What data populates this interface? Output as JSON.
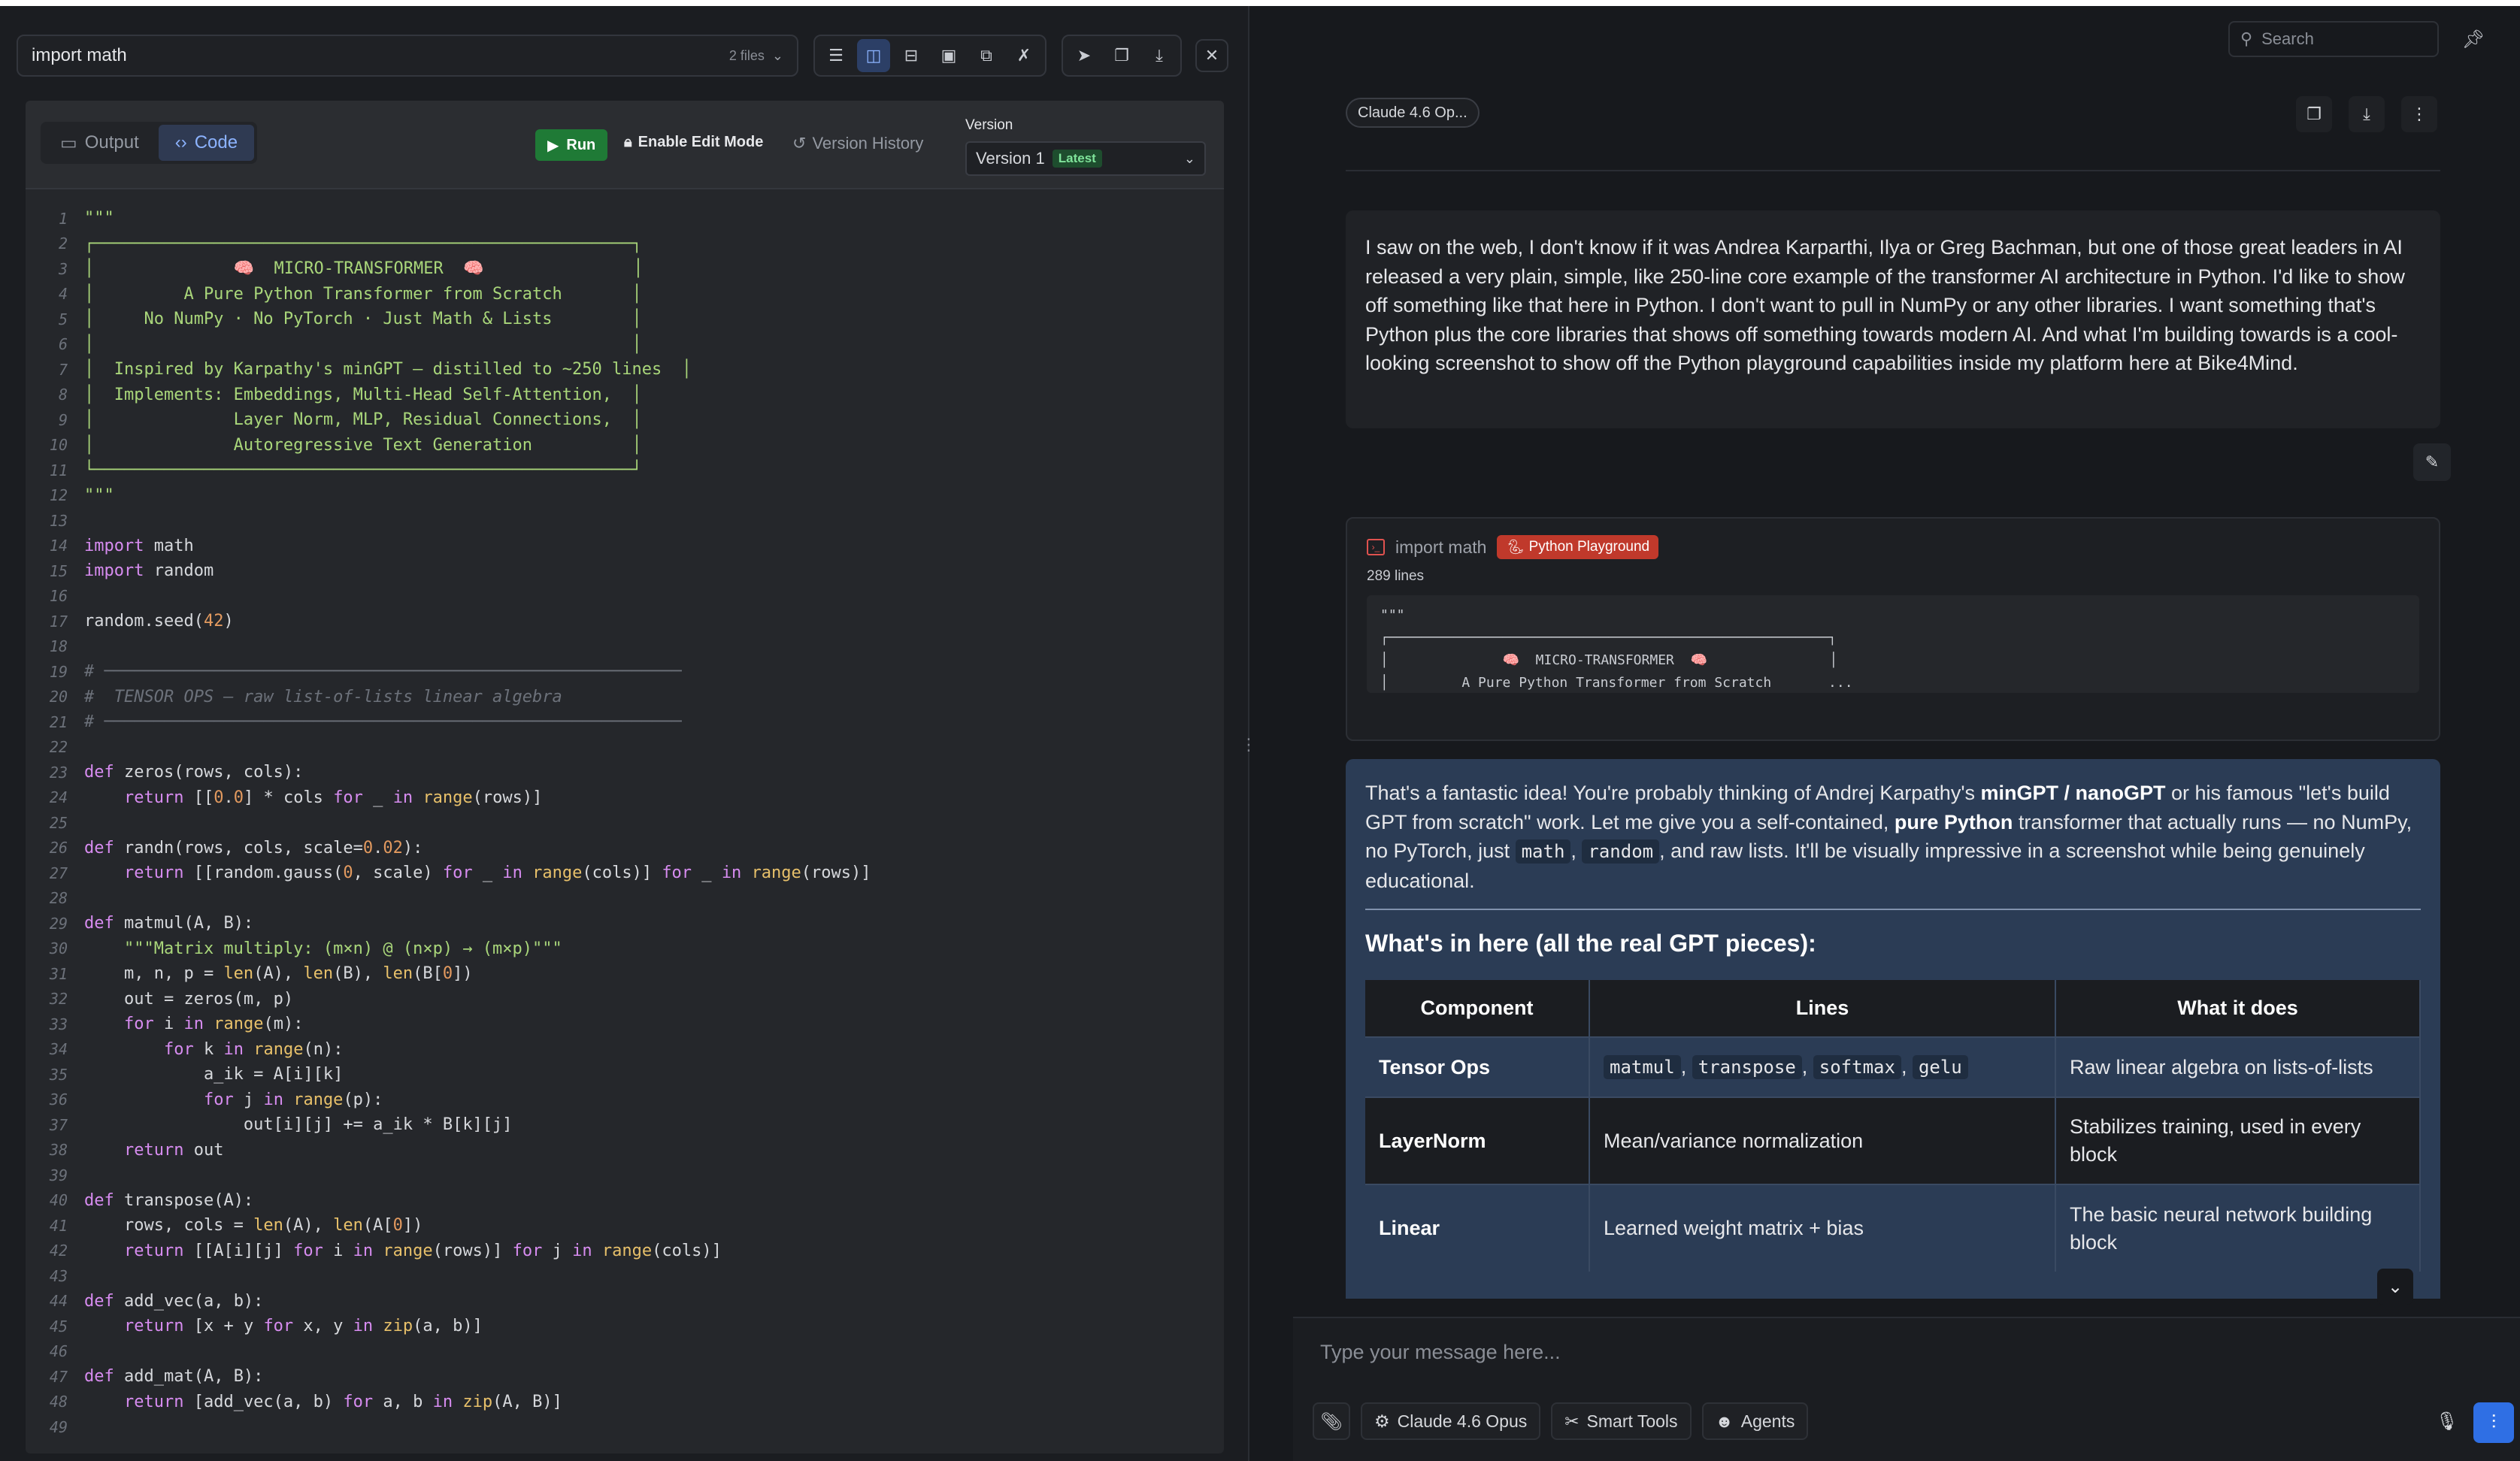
{
  "left": {
    "file_name": "import math",
    "file_count": "2 files",
    "toolbar_icons": [
      "list-icon",
      "split-horizontal-icon",
      "split-vertical-icon",
      "picture-in-picture-icon",
      "external-link-icon",
      "no-wrap-icon",
      "send-icon",
      "copy-icon",
      "download-icon"
    ],
    "close": "✕",
    "tabs": {
      "output": "Output",
      "code": "Code"
    },
    "run": "Run",
    "edit_mode": "Enable Edit Mode",
    "version_history": "Version History",
    "version_label": "Version",
    "version_value": "Version 1",
    "version_badge": "Latest"
  },
  "right": {
    "search_placeholder": "Search",
    "model_chip": "Claude 4.6 Op...",
    "user_message": "I saw on the web, I don't know if it was Andrea Karparthi, Ilya or Greg Bachman, but one of those great leaders in AI released a very plain, simple, like 250-line core example of the transformer AI architecture in Python. I'd like to show off something like that here in Python. I don't want to pull in NumPy or any other libraries. I want something that's Python plus the core libraries that shows off something towards modern AI. And what I'm building towards is a cool-looking screenshot to show off the Python playground capabilities inside my platform here at Bike4Mind.",
    "artifact": {
      "title": "import math",
      "badge": "Python Playground",
      "line_count": "289 lines",
      "preview": "\"\"\"\n┌──────────────────────────────────────────────────────┐\n│              🧠  MICRO-TRANSFORMER  🧠               │\n│         A Pure Python Transformer from Scratch       ..."
    },
    "assistant": {
      "intro_1": "That's a fantastic idea! You're probably thinking of Andrej Karpathy's ",
      "intro_bold_1": "minGPT / nanoGPT",
      "intro_2": " or his famous \"let's build GPT from scratch\" work. Let me give you a self-contained, ",
      "intro_bold_2": "pure Python",
      "intro_3": " transformer that actually runs — no NumPy, no PyTorch, just ",
      "code_math": "math",
      "sep": ", ",
      "code_random": "random",
      "intro_4": ", and raw lists. It'll be visually impressive in a screenshot while being genuinely educational.",
      "heading": "What's in here (all the real GPT pieces):",
      "table_headers": [
        "Component",
        "Lines",
        "What it does"
      ],
      "rows": [
        {
          "component": "Tensor Ops",
          "lines": [
            "matmul",
            "transpose",
            "softmax",
            "gelu"
          ],
          "does": "Raw linear algebra on lists-of-lists"
        },
        {
          "component": "LayerNorm",
          "lines_text": "Mean/variance normalization",
          "does": "Stabilizes training, used in every block"
        },
        {
          "component": "Linear",
          "lines_text": "Learned weight matrix + bias",
          "does": "The basic neural network building block"
        }
      ]
    },
    "composer": {
      "placeholder": "Type your message here...",
      "model": "Claude 4.6 Opus",
      "smart_tools": "Smart Tools",
      "agents": "Agents"
    }
  },
  "code_lines": [
    "\"\"\"",
    "┌──────────────────────────────────────────────────────┐",
    "│              🧠  MICRO-TRANSFORMER  🧠               │",
    "│         A Pure Python Transformer from Scratch       │",
    "│     No NumPy · No PyTorch · Just Math & Lists        │",
    "│                                                      │",
    "│  Inspired by Karpathy's minGPT — distilled to ~250 lines  │",
    "│  Implements: Embeddings, Multi-Head Self-Attention,  │",
    "│              Layer Norm, MLP, Residual Connections,  │",
    "│              Autoregressive Text Generation          │",
    "└──────────────────────────────────────────────────────┘",
    "\"\"\"",
    "",
    "import math",
    "import random",
    "",
    "random.seed(42)",
    "",
    "# ──────────────────────────────────────────────────────────",
    "#  TENSOR OPS — raw list-of-lists linear algebra",
    "# ──────────────────────────────────────────────────────────",
    "",
    "def zeros(rows, cols):",
    "    return [[0.0] * cols for _ in range(rows)]",
    "",
    "def randn(rows, cols, scale=0.02):",
    "    return [[random.gauss(0, scale) for _ in range(cols)] for _ in range(rows)]",
    "",
    "def matmul(A, B):",
    "    \"\"\"Matrix multiply: (m×n) @ (n×p) → (m×p)\"\"\"",
    "    m, n, p = len(A), len(B), len(B[0])",
    "    out = zeros(m, p)",
    "    for i in range(m):",
    "        for k in range(n):",
    "            a_ik = A[i][k]",
    "            for j in range(p):",
    "                out[i][j] += a_ik * B[k][j]",
    "    return out",
    "",
    "def transpose(A):",
    "    rows, cols = len(A), len(A[0])",
    "    return [[A[i][j] for i in range(rows)] for j in range(cols)]",
    "",
    "def add_vec(a, b):",
    "    return [x + y for x, y in zip(a, b)]",
    "",
    "def add_mat(A, B):",
    "    return [add_vec(a, b) for a, b in zip(A, B)]",
    ""
  ]
}
